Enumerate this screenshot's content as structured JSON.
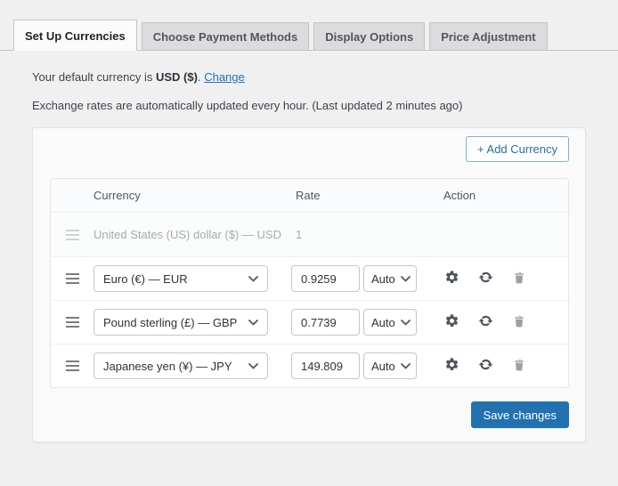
{
  "tabs": [
    {
      "label": "Set Up Currencies",
      "active": true
    },
    {
      "label": "Choose Payment Methods",
      "active": false
    },
    {
      "label": "Display Options",
      "active": false
    },
    {
      "label": "Price Adjustment",
      "active": false
    }
  ],
  "intro": {
    "default_prefix": "Your default currency is",
    "default_currency": "USD ($)",
    "default_suffix": ".",
    "change_link": "Change",
    "exchange_note": "Exchange rates are automatically updated every hour. (Last updated 2 minutes ago)"
  },
  "panel": {
    "add_currency_label": "+ Add Currency",
    "table": {
      "headers": {
        "currency": "Currency",
        "rate": "Rate",
        "action": "Action"
      },
      "default_row": {
        "currency": "United States (US) dollar ($) — USD",
        "rate": "1"
      },
      "rows": [
        {
          "currency": "Euro (€) — EUR",
          "rate": "0.9259",
          "mode": "Auto"
        },
        {
          "currency": "Pound sterling (£) — GBP",
          "rate": "0.7739",
          "mode": "Auto"
        },
        {
          "currency": "Japanese yen (¥) — JPY",
          "rate": "149.809",
          "mode": "Auto"
        }
      ]
    },
    "save_label": "Save changes"
  },
  "icons": {
    "drag_handle": "three-bars-drag-handle",
    "chevron": "chevron-down",
    "gear": "settings-gear",
    "update": "refresh-circular-arrows",
    "trash": "trash-can"
  },
  "colors": {
    "accent": "#2271b1",
    "link": "#2271b1",
    "page_bg": "#f0f0f1",
    "panel_bg": "#fafafb",
    "tab_inactive_bg": "#dcdcde",
    "muted_text": "#a7aaad",
    "icon_dark": "#50575e",
    "icon_light": "#8c8f94"
  }
}
